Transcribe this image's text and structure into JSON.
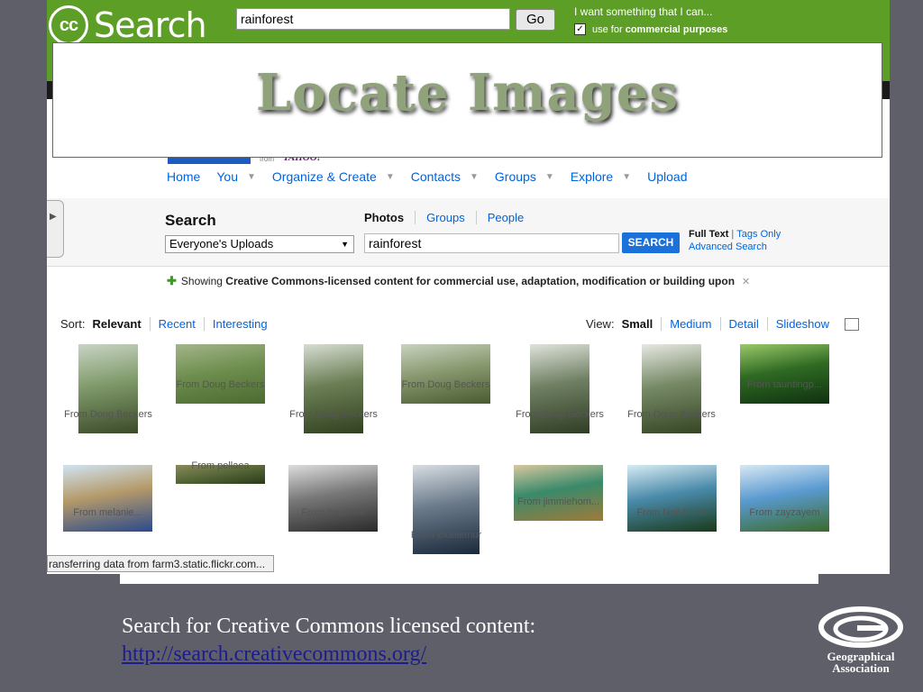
{
  "slide": {
    "title": "Locate Images",
    "caption": "Search for Creative Commons licensed content:",
    "link": "http://search.creativecommons.org/",
    "org_logo_text": [
      "Geographical",
      "Association"
    ]
  },
  "cc": {
    "logo_text": "cc",
    "logo_word": "Search",
    "query": "rainforest",
    "go_label": "Go",
    "want_label": "I want something that I can...",
    "use_prefix": "use for ",
    "use_bold": "commercial purposes"
  },
  "flickr": {
    "from_label": "from",
    "yahoo_label": "YAHOO!",
    "nav": [
      {
        "label": "Home",
        "caret": false
      },
      {
        "label": "You",
        "caret": true
      },
      {
        "label": "Organize & Create",
        "caret": true
      },
      {
        "label": "Contacts",
        "caret": true
      },
      {
        "label": "Groups",
        "caret": true
      },
      {
        "label": "Explore",
        "caret": true
      },
      {
        "label": "Upload",
        "caret": false
      }
    ],
    "search_label": "Search",
    "scope": "Everyone's Uploads",
    "type_tabs": [
      "Photos",
      "Groups",
      "People"
    ],
    "query": "rainforest",
    "search_button": "SEARCH",
    "full_text": "Full Text",
    "tags_only": "Tags Only",
    "advanced": "Advanced Search",
    "notice_prefix": "Showing ",
    "notice_bold": "Creative Commons-licensed content for commercial use, adaptation, modification or building upon",
    "sort_label": "Sort:",
    "sort_options": [
      "Relevant",
      "Recent",
      "Interesting"
    ],
    "view_label": "View:",
    "view_options": [
      "Small",
      "Medium",
      "Detail",
      "Slideshow"
    ],
    "thumbs": [
      {
        "caption": "From Doug Beckers",
        "colors": [
          "#3c4a2a",
          "#7f9a6a",
          "#c9d4c4"
        ]
      },
      {
        "caption": "From Doug Beckers",
        "colors": [
          "#4a6a30",
          "#6f8f4f",
          "#a3b58a"
        ]
      },
      {
        "caption": "From Doug Beckers",
        "colors": [
          "#324020",
          "#6b7f55",
          "#d7ddd2"
        ]
      },
      {
        "caption": "From Doug Beckers",
        "colors": [
          "#4a5a30",
          "#8a9a70",
          "#c8d2c0"
        ]
      },
      {
        "caption": "From Doug Beckers",
        "colors": [
          "#2f3d24",
          "#6f7f62",
          "#dfe3db"
        ]
      },
      {
        "caption": "From Doug Beckers",
        "colors": [
          "#354525",
          "#778a66",
          "#e6e8e2"
        ]
      },
      {
        "caption": "From tauntingp...",
        "colors": [
          "#0f3010",
          "#2f6a22",
          "#9ac86a"
        ]
      },
      {
        "caption": "From melanie...",
        "colors": [
          "#2a4a8a",
          "#b59a6a",
          "#d0e4f2"
        ]
      },
      {
        "caption": "From pellaea",
        "colors": [
          "#2a3a1a",
          "#5a6a3a",
          "#8a8a5a"
        ]
      },
      {
        "caption": "From jsawkins",
        "colors": [
          "#2a2a2a",
          "#777777",
          "#dddddd"
        ]
      },
      {
        "caption": "From Bluelemur",
        "colors": [
          "#1a2a3a",
          "#6a7a8a",
          "#d8dde2"
        ]
      },
      {
        "caption": "From jimmiehom...",
        "colors": [
          "#a07a3a",
          "#3a8a6a",
          "#d8c8a0"
        ]
      },
      {
        "caption": "From Neil Ennis",
        "colors": [
          "#1a3a1a",
          "#4a8aaa",
          "#d8ecf4"
        ]
      },
      {
        "caption": "From zayzayem",
        "colors": [
          "#3a6a2a",
          "#5a9ad0",
          "#d8e8f4"
        ]
      }
    ]
  },
  "browser": {
    "status": "ransferring data from farm3.static.flickr.com..."
  }
}
